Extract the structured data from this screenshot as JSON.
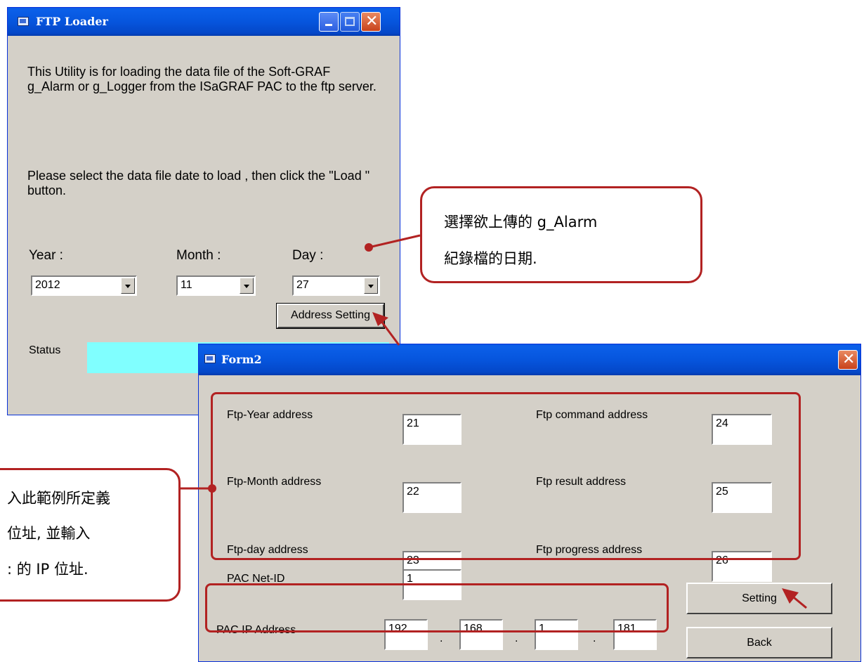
{
  "ftp_loader": {
    "title": "FTP Loader",
    "description": "This Utility is for loading the data file of the Soft-GRAF g_Alarm or g_Logger from the ISaGRAF PAC to the ftp server.",
    "instruction": "Please select the data file  date to load , then click the \"Load \" button.",
    "year_label": "Year :",
    "month_label": "Month :",
    "day_label": "Day :",
    "year_value": "2012",
    "month_value": "11",
    "day_value": "27",
    "address_setting_button": "Address Setting",
    "status_label": "Status",
    "status_value": ""
  },
  "form2": {
    "title": "Form2",
    "fields_left": [
      {
        "label": "Ftp-Year address",
        "value": "21"
      },
      {
        "label": "Ftp-Month address",
        "value": "22"
      },
      {
        "label": "Ftp-day address",
        "value": "23"
      }
    ],
    "fields_right": [
      {
        "label": "Ftp command address",
        "value": "24"
      },
      {
        "label": "Ftp result address",
        "value": "25"
      },
      {
        "label": "Ftp progress address",
        "value": "26"
      }
    ],
    "net_id_label": "PAC Net-ID",
    "net_id_value": "1",
    "ip_label": "PAC IP Address",
    "ip_octets": [
      "192",
      "168",
      "1",
      "181"
    ],
    "ip_separator": ".",
    "setting_button": "Setting",
    "back_button": "Back"
  },
  "annotations": {
    "date_callout_line1": "選擇欲上傳的  g_Alarm",
    "date_callout_line2": "紀錄檔的日期.",
    "address_callout_line1": "入此範例所定義",
    "address_callout_line2": "位址, 並輸入",
    "address_callout_line3": ": 的  IP  位址."
  },
  "colors": {
    "titlebar_blue": "#0655dd",
    "window_gray": "#d4d0c8",
    "status_cyan": "#80ffff",
    "annotation_red": "#b22222"
  }
}
